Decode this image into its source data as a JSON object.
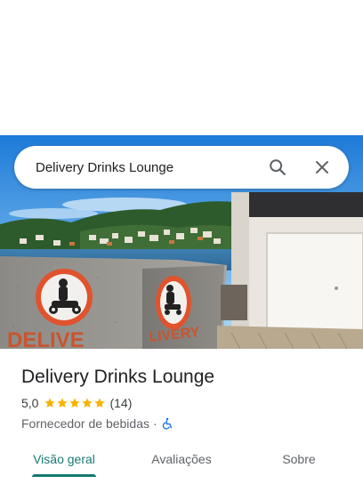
{
  "search": {
    "query": "Delivery Drinks Lounge"
  },
  "icons": {
    "search": "search-icon",
    "close": "close-icon",
    "star": "star-icon",
    "accessibility": "wheelchair-icon"
  },
  "place": {
    "name": "Delivery Drinks Lounge",
    "rating_text": "5,0",
    "rating_value": 5,
    "rating_max": 5,
    "review_count": "(14)",
    "category": "Fornecedor de bebidas",
    "separator": "·"
  },
  "tabs": [
    {
      "label": "Visão geral",
      "active": true
    },
    {
      "label": "Avaliações",
      "active": false
    },
    {
      "label": "Sobre",
      "active": false
    }
  ],
  "colors": {
    "accent": "#1a7a74",
    "star": "#f7b400",
    "accessibility": "#1a73e8"
  }
}
